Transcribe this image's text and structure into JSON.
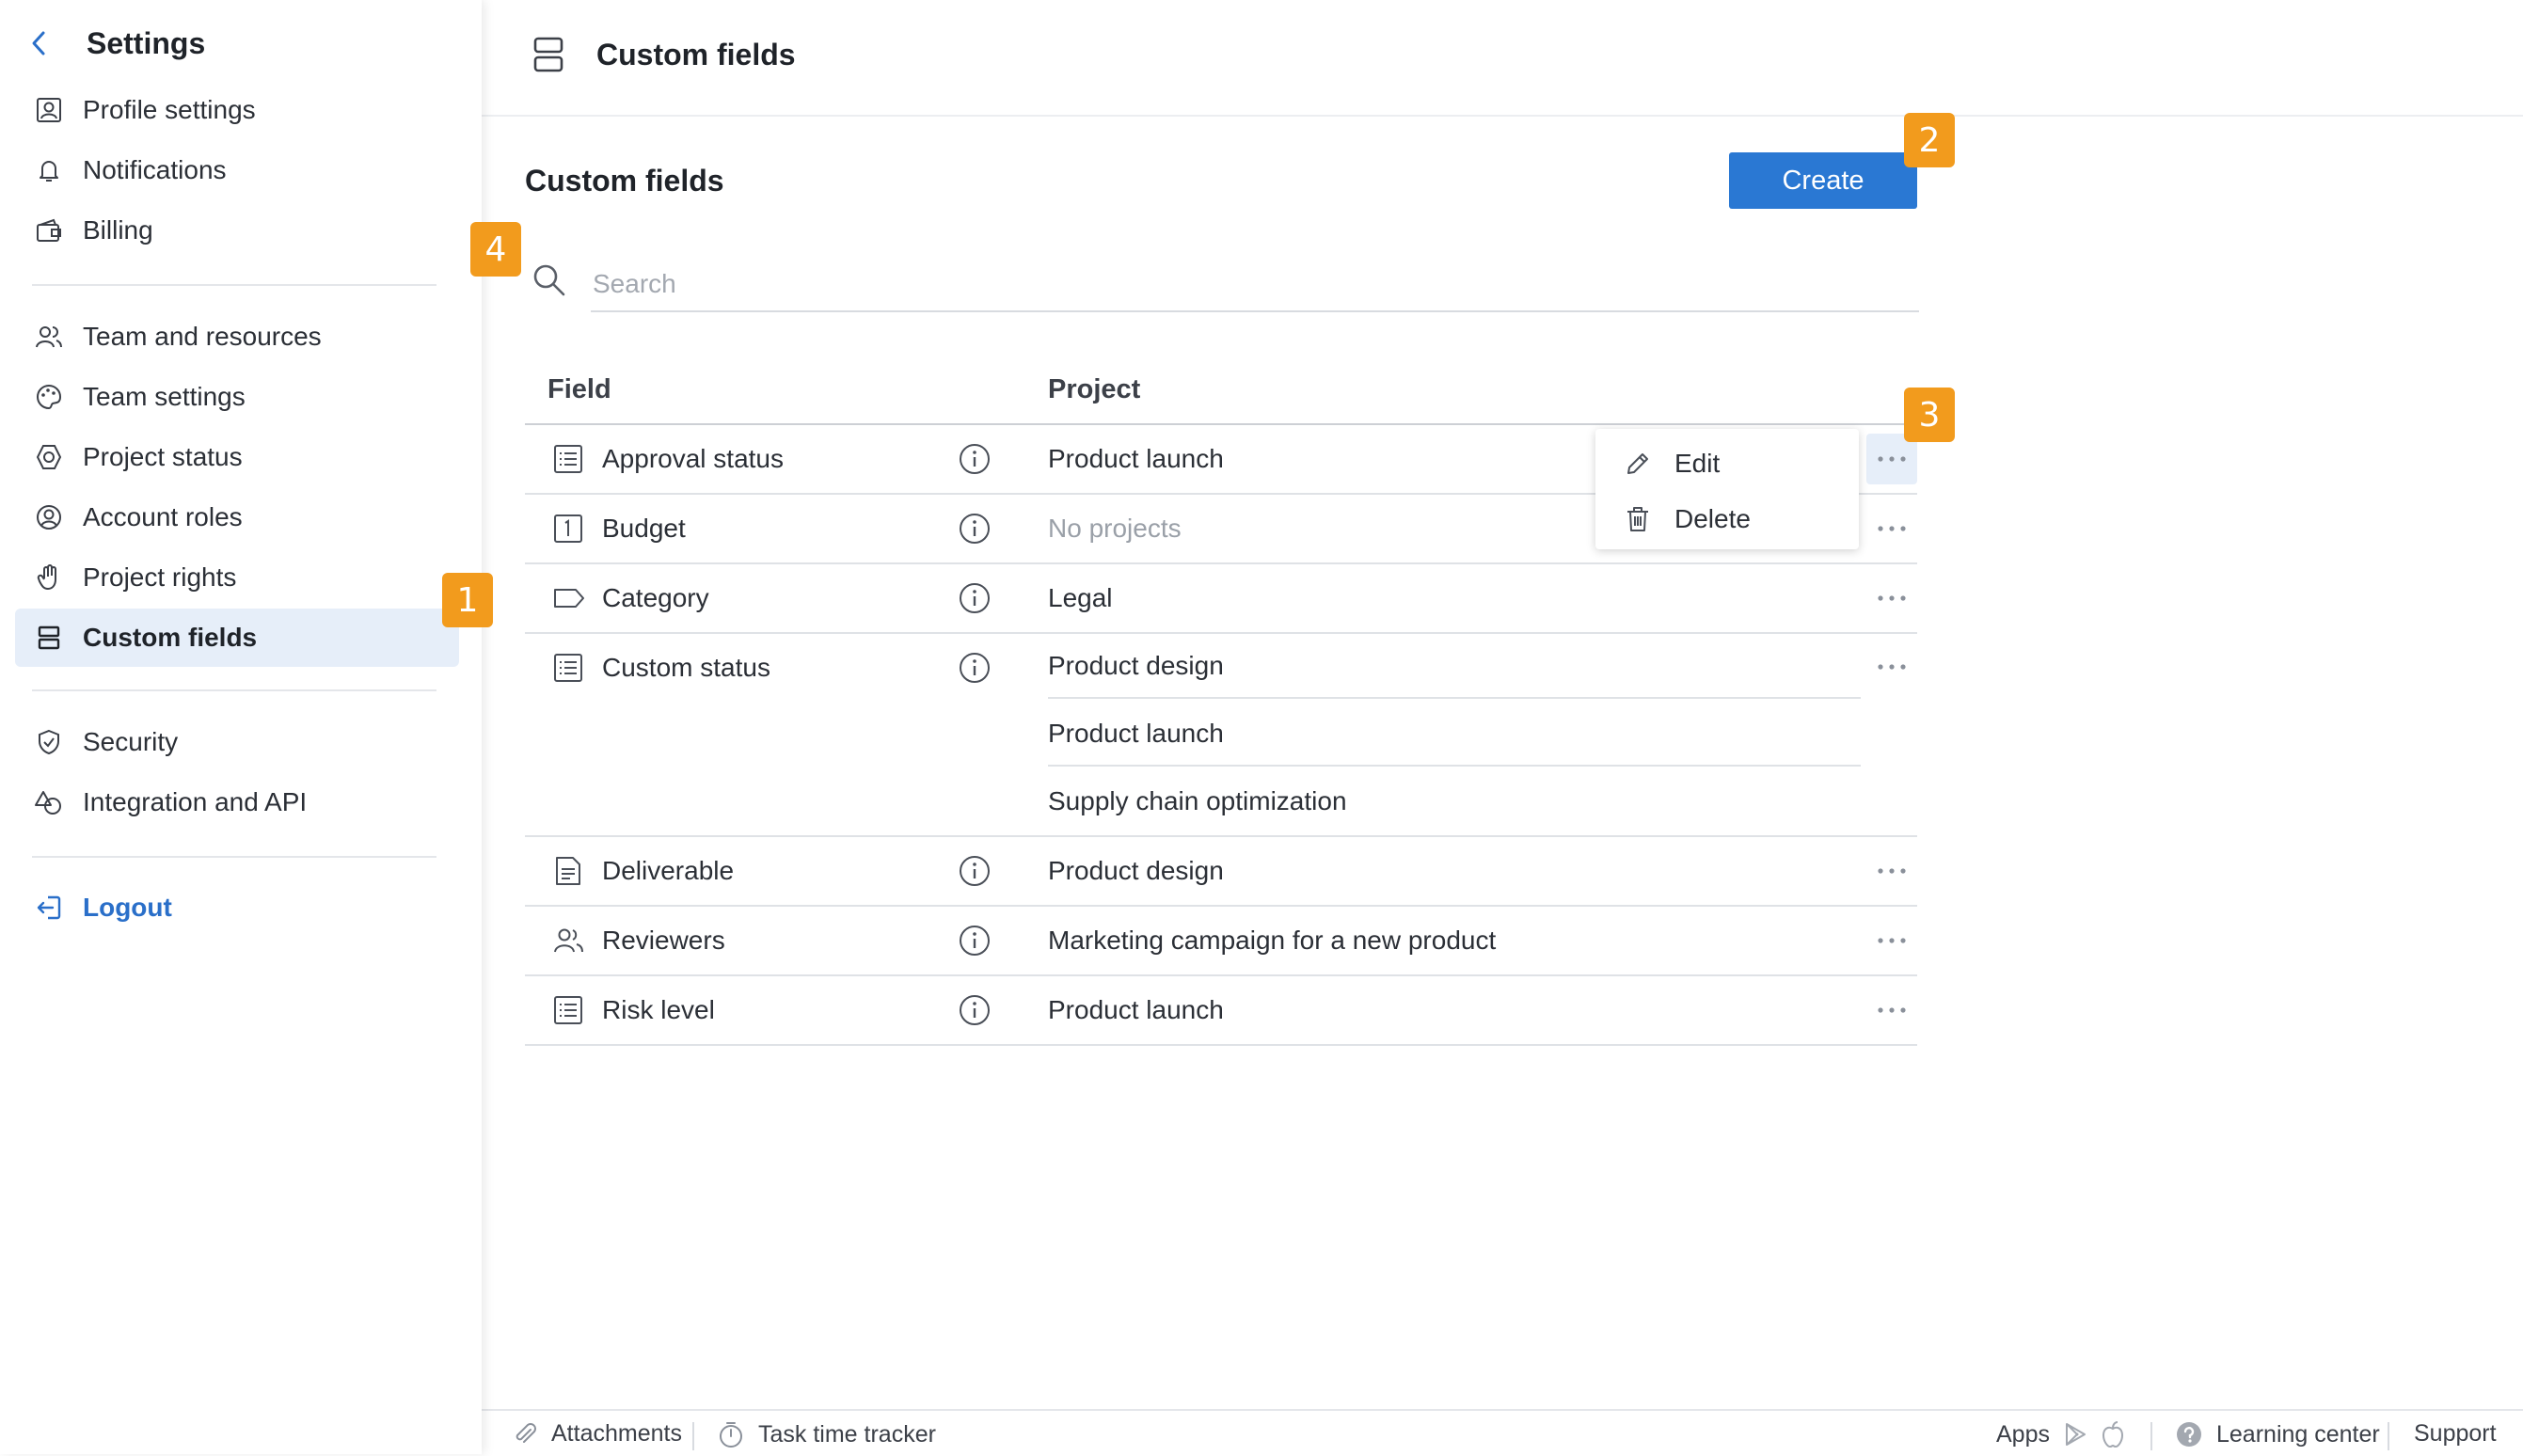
{
  "sidebar": {
    "title": "Settings",
    "items": [
      {
        "label": "Profile settings",
        "icon": "profile-icon"
      },
      {
        "label": "Notifications",
        "icon": "bell-icon"
      },
      {
        "label": "Billing",
        "icon": "wallet-icon"
      },
      {
        "label": "Team and resources",
        "icon": "team-icon"
      },
      {
        "label": "Team settings",
        "icon": "palette-icon"
      },
      {
        "label": "Project status",
        "icon": "status-icon"
      },
      {
        "label": "Account roles",
        "icon": "account-icon"
      },
      {
        "label": "Project rights",
        "icon": "hand-icon"
      },
      {
        "label": "Custom fields",
        "icon": "custom-fields-icon",
        "active": true
      },
      {
        "label": "Security",
        "icon": "shield-icon"
      },
      {
        "label": "Integration and API",
        "icon": "integration-icon"
      }
    ],
    "logout": "Logout"
  },
  "header": {
    "title": "Custom fields"
  },
  "main": {
    "title": "Custom fields",
    "create_label": "Create",
    "search_placeholder": "Search",
    "columns": {
      "field": "Field",
      "project": "Project"
    },
    "rows": [
      {
        "field": "Approval status",
        "icon": "list-icon",
        "projects": [
          "Product launch"
        ]
      },
      {
        "field": "Budget",
        "icon": "number-icon",
        "projects": [
          "No projects"
        ],
        "empty": true
      },
      {
        "field": "Category",
        "icon": "tag-icon",
        "projects": [
          "Legal"
        ]
      },
      {
        "field": "Custom status",
        "icon": "list-icon",
        "projects": [
          "Product design",
          "Product launch",
          "Supply chain optimization"
        ]
      },
      {
        "field": "Deliverable",
        "icon": "document-icon",
        "projects": [
          "Product design"
        ]
      },
      {
        "field": "Reviewers",
        "icon": "users-icon",
        "projects": [
          "Marketing campaign for a new product"
        ]
      },
      {
        "field": "Risk level",
        "icon": "list-icon",
        "projects": [
          "Product launch"
        ]
      }
    ]
  },
  "context_menu": {
    "edit": "Edit",
    "delete": "Delete"
  },
  "badges": [
    "1",
    "2",
    "3",
    "4"
  ],
  "footer": {
    "attachments": "Attachments",
    "time_tracker": "Task time tracker",
    "apps": "Apps",
    "learning_center": "Learning center",
    "support": "Support"
  },
  "colors": {
    "accent": "#2a78d3",
    "badge": "#f29b1d",
    "active_bg": "#e6eef9"
  }
}
